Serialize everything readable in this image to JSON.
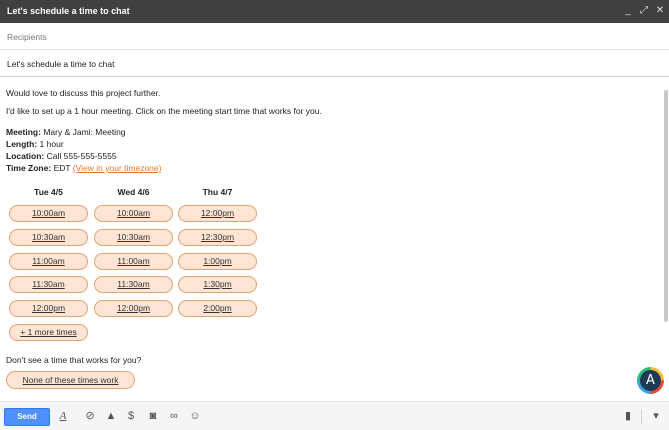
{
  "window": {
    "title": "Let's schedule a time to chat",
    "controls": {
      "minimize": "_",
      "expand": "⤢",
      "close": "✕"
    }
  },
  "recipients": {
    "placeholder": "Recipients"
  },
  "subject": {
    "value": "Let's schedule a time to chat"
  },
  "body": {
    "intro": "Would love to discuss this project further.",
    "request": "I'd like to set up a 1 hour meeting. Click on the meeting start time that works for you.",
    "meeting_label": "Meeting:",
    "meeting_value": "Mary & Jami: Meeting",
    "length_label": "Length:",
    "length_value": "1 hour",
    "location_label": "Location:",
    "location_value": "Call 555-555-5555",
    "timezone_label": "Time Zone:",
    "timezone_value": "EDT",
    "timezone_link": "(View in your timezone)"
  },
  "days": [
    {
      "label": "Tue 4/5",
      "slots": [
        "10:00am",
        "10:30am",
        "11:00am",
        "11:30am",
        "12:00pm"
      ]
    },
    {
      "label": "Wed 4/6",
      "slots": [
        "10:00am",
        "10:30am",
        "11:00am",
        "11:30am",
        "12:00pm"
      ]
    },
    {
      "label": "Thu 4/7",
      "slots": [
        "12:00pm",
        "12:30pm",
        "1:00pm",
        "1:30pm",
        "2:00pm"
      ]
    }
  ],
  "more_times": "+ 1 more times",
  "no_time_prompt": "Don't see a time that works for you?",
  "none_button": "None of these times work",
  "avatar_letter": "A",
  "toolbar": {
    "send_label": "Send",
    "icons": {
      "format": "A",
      "attach": "⊘",
      "drive": "▲",
      "money": "$",
      "photo": "◙",
      "link": "∞",
      "emoji": "☺",
      "trash": "▮",
      "more": "▾"
    }
  }
}
